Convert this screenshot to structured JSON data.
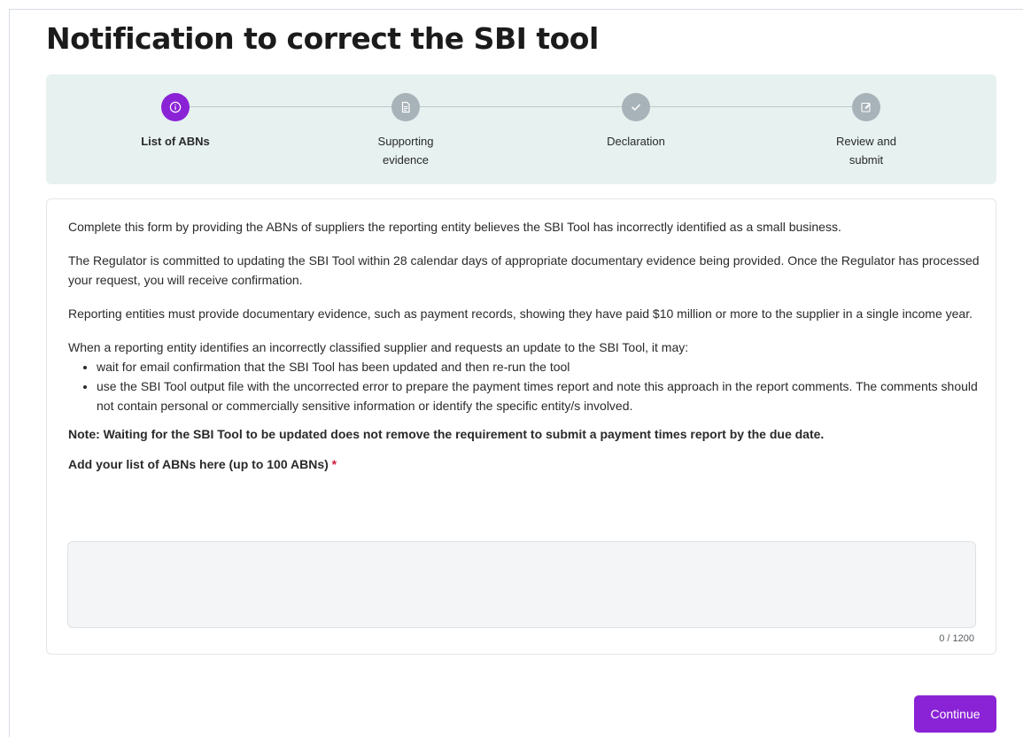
{
  "page": {
    "title": "Notification to correct the SBI tool"
  },
  "stepper": {
    "steps": [
      {
        "label": "List of ABNs",
        "icon": "info-icon",
        "active": true
      },
      {
        "label": "Supporting\nevidence",
        "icon": "document-icon",
        "active": false
      },
      {
        "label": "Declaration",
        "icon": "check-icon",
        "active": false
      },
      {
        "label": "Review and\nsubmit",
        "icon": "edit-icon",
        "active": false
      }
    ],
    "colors": {
      "active": "#8a23d6",
      "inactive": "#a7b3b9",
      "background": "#e6f1f0"
    }
  },
  "content": {
    "intro": "Complete this form by providing the ABNs of suppliers the reporting entity believes the SBI Tool has incorrectly identified as a small business.",
    "commitment": "The Regulator is committed to updating the SBI Tool within 28 calendar days of appropriate documentary evidence being provided. Once the Regulator has processed your request, you will receive confirmation.",
    "evidence": "Reporting entities must provide documentary evidence, such as payment records, showing they have paid $10 million or more to the supplier in a single income year.",
    "options_intro": "When a reporting entity identifies an incorrectly classified supplier and requests an update to the SBI Tool, it may:",
    "options": [
      "wait for email confirmation that the SBI Tool has been updated and then re-run the tool",
      "use the SBI Tool output file with the uncorrected error to prepare the payment times report and note this approach in the report comments. The comments should not contain personal or commercially sensitive information or identify the specific entity/s involved."
    ],
    "note": "Note: Waiting for the SBI Tool to be updated does not remove the requirement to submit a payment times report by the due date."
  },
  "abn_field": {
    "label": "Add your list of ABNs here (up to 100 ABNs)",
    "required_marker": "*",
    "value": "",
    "char_count": "0 / 1200"
  },
  "actions": {
    "continue_label": "Continue"
  },
  "colors": {
    "accent": "#8a23d6",
    "required": "#d11b3a"
  }
}
